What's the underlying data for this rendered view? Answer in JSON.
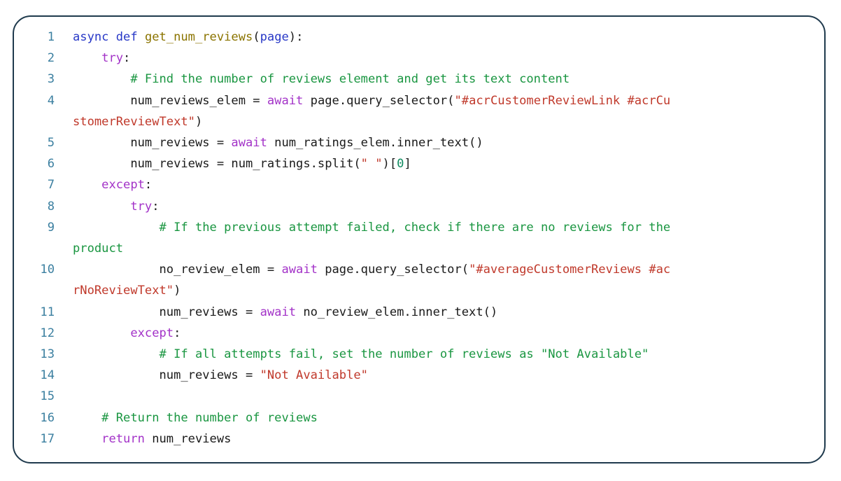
{
  "card": {
    "border_color": "#1f3a4d",
    "background": "#ffffff",
    "language": "python"
  },
  "theme": {
    "line_number_color": "#3b7fa0",
    "keyword_color": "#2838c7",
    "function_color": "#8b7400",
    "control_keyword_color": "#a333c8",
    "comment_color": "#1a9641",
    "string_color": "#c0392b",
    "number_color": "#0e8a5f",
    "plain_color": "#1a1a1a"
  },
  "code": {
    "lines": [
      {
        "n": "1",
        "indent": 0,
        "segments": [
          {
            "t": "async",
            "c": "kw"
          },
          {
            "t": " ",
            "c": "pl"
          },
          {
            "t": "def",
            "c": "kw"
          },
          {
            "t": " ",
            "c": "pl"
          },
          {
            "t": "get_num_reviews",
            "c": "fn"
          },
          {
            "t": "(",
            "c": "pl"
          },
          {
            "t": "page",
            "c": "par"
          },
          {
            "t": "):",
            "c": "pl"
          }
        ]
      },
      {
        "n": "2",
        "indent": 0,
        "segments": [
          {
            "t": "    ",
            "c": "pl"
          },
          {
            "t": "try",
            "c": "ctl"
          },
          {
            "t": ":",
            "c": "pl"
          }
        ]
      },
      {
        "n": "3",
        "indent": 0,
        "segments": [
          {
            "t": "        ",
            "c": "pl"
          },
          {
            "t": "# Find the number of reviews element and get its text content",
            "c": "com"
          }
        ]
      },
      {
        "n": "4",
        "indent": 0,
        "segments": [
          {
            "t": "        num_reviews_elem ",
            "c": "pl"
          },
          {
            "t": "=",
            "c": "op"
          },
          {
            "t": " ",
            "c": "pl"
          },
          {
            "t": "await",
            "c": "ctl"
          },
          {
            "t": " page.query_selector(",
            "c": "pl"
          },
          {
            "t": "\"#acrCustomerReviewLink #acrCu",
            "c": "str"
          }
        ]
      },
      {
        "n": "4c",
        "cont": true,
        "indent": 0,
        "segments": [
          {
            "t": "stomerReviewText\"",
            "c": "str"
          },
          {
            "t": ")",
            "c": "pl"
          }
        ]
      },
      {
        "n": "5",
        "indent": 0,
        "segments": [
          {
            "t": "        num_reviews ",
            "c": "pl"
          },
          {
            "t": "=",
            "c": "op"
          },
          {
            "t": " ",
            "c": "pl"
          },
          {
            "t": "await",
            "c": "ctl"
          },
          {
            "t": " num_ratings_elem.inner_text()",
            "c": "pl"
          }
        ]
      },
      {
        "n": "6",
        "indent": 0,
        "segments": [
          {
            "t": "        num_reviews ",
            "c": "pl"
          },
          {
            "t": "=",
            "c": "op"
          },
          {
            "t": " num_ratings.split(",
            "c": "pl"
          },
          {
            "t": "\" \"",
            "c": "str"
          },
          {
            "t": ")[",
            "c": "pl"
          },
          {
            "t": "0",
            "c": "num"
          },
          {
            "t": "]",
            "c": "pl"
          }
        ]
      },
      {
        "n": "7",
        "indent": 0,
        "segments": [
          {
            "t": "    ",
            "c": "pl"
          },
          {
            "t": "except",
            "c": "ctl"
          },
          {
            "t": ":",
            "c": "pl"
          }
        ]
      },
      {
        "n": "8",
        "indent": 0,
        "segments": [
          {
            "t": "        ",
            "c": "pl"
          },
          {
            "t": "try",
            "c": "ctl"
          },
          {
            "t": ":",
            "c": "pl"
          }
        ]
      },
      {
        "n": "9",
        "indent": 0,
        "segments": [
          {
            "t": "            ",
            "c": "pl"
          },
          {
            "t": "# If the previous attempt failed, check if there are no reviews for the",
            "c": "com"
          }
        ]
      },
      {
        "n": "9c",
        "cont": true,
        "indent": 0,
        "segments": [
          {
            "t": "product",
            "c": "com"
          }
        ]
      },
      {
        "n": "10",
        "indent": 0,
        "segments": [
          {
            "t": "            no_review_elem ",
            "c": "pl"
          },
          {
            "t": "=",
            "c": "op"
          },
          {
            "t": " ",
            "c": "pl"
          },
          {
            "t": "await",
            "c": "ctl"
          },
          {
            "t": " page.query_selector(",
            "c": "pl"
          },
          {
            "t": "\"#averageCustomerReviews #ac",
            "c": "str"
          }
        ]
      },
      {
        "n": "10c",
        "cont": true,
        "indent": 0,
        "segments": [
          {
            "t": "rNoReviewText\"",
            "c": "str"
          },
          {
            "t": ")",
            "c": "pl"
          }
        ]
      },
      {
        "n": "11",
        "indent": 0,
        "segments": [
          {
            "t": "            num_reviews ",
            "c": "pl"
          },
          {
            "t": "=",
            "c": "op"
          },
          {
            "t": " ",
            "c": "pl"
          },
          {
            "t": "await",
            "c": "ctl"
          },
          {
            "t": " no_review_elem.inner_text()",
            "c": "pl"
          }
        ]
      },
      {
        "n": "12",
        "indent": 0,
        "segments": [
          {
            "t": "        ",
            "c": "pl"
          },
          {
            "t": "except",
            "c": "ctl"
          },
          {
            "t": ":",
            "c": "pl"
          }
        ]
      },
      {
        "n": "13",
        "indent": 0,
        "segments": [
          {
            "t": "            ",
            "c": "pl"
          },
          {
            "t": "# If all attempts fail, set the number of reviews as \"Not Available\"",
            "c": "com"
          }
        ]
      },
      {
        "n": "14",
        "indent": 0,
        "segments": [
          {
            "t": "            num_reviews ",
            "c": "pl"
          },
          {
            "t": "=",
            "c": "op"
          },
          {
            "t": " ",
            "c": "pl"
          },
          {
            "t": "\"Not Available\"",
            "c": "str"
          }
        ]
      },
      {
        "n": "15",
        "indent": 0,
        "segments": []
      },
      {
        "n": "16",
        "indent": 0,
        "segments": [
          {
            "t": "    ",
            "c": "pl"
          },
          {
            "t": "# Return the number of reviews",
            "c": "com"
          }
        ]
      },
      {
        "n": "17",
        "indent": 0,
        "segments": [
          {
            "t": "    ",
            "c": "pl"
          },
          {
            "t": "return",
            "c": "ctl"
          },
          {
            "t": " num_reviews",
            "c": "pl"
          }
        ]
      }
    ]
  }
}
